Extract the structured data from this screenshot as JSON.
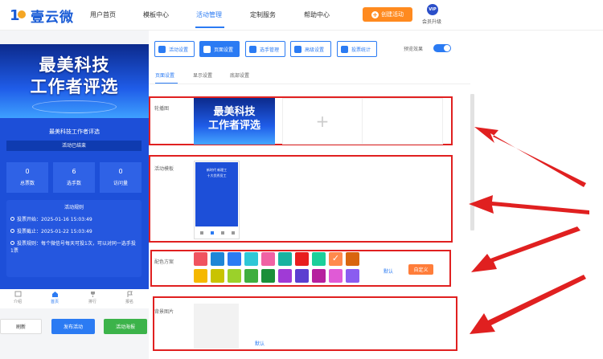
{
  "brand": {
    "name": "壹云微"
  },
  "nav": {
    "items": [
      "用户首页",
      "模板中心",
      "活动管理",
      "定制服务",
      "帮助中心"
    ],
    "create_label": "创建活动",
    "vip_badge": "VIP",
    "vip_label": "会员升级"
  },
  "preview": {
    "banner_line1": "最美科技",
    "banner_line2": "工作者评选",
    "title": "最美科技工作者评选",
    "status": "活动已结束",
    "stats": [
      {
        "value": "0",
        "label": "总票数"
      },
      {
        "value": "6",
        "label": "选手数"
      },
      {
        "value": "0",
        "label": "访问量"
      }
    ],
    "rules_header": "活动规则",
    "rules": [
      "投票开始：2025-01-16 15:03:49",
      "投票截止：2025-01-22 15:03:49",
      "投票规则：每个微信号每天可投1次，可以对同一选手投1票"
    ],
    "tabs": [
      "介绍",
      "首页",
      "排行",
      "报名"
    ],
    "actions": {
      "refresh": "刷新",
      "publish": "发布活动",
      "poster": "活动海报"
    }
  },
  "settings": {
    "buttons": [
      "活动设置",
      "页面设置",
      "选手管理",
      "高级设置",
      "投票统计"
    ],
    "preview_toggle_label": "预览效果",
    "preview_toggle_on": true,
    "subtabs": [
      "页面设置",
      "显示设置",
      "底部设置"
    ],
    "carousel_label": "轮播图",
    "carousel_line1": "最美科技",
    "carousel_line2": "工作者评选",
    "template_label": "活动模板",
    "template_thumb": [
      "新时代 新理工",
      "十大优秀员工"
    ],
    "color_label": "配色方案",
    "colors_row1": [
      "#f0535f",
      "#1f86d6",
      "#2b7bf3",
      "#2ec7d6",
      "#f062a4",
      "#19b3a1",
      "#e81e1e",
      "#1ccf9a",
      "#ff8a4c",
      "#d9650f"
    ],
    "colors_row2": [
      "#f5b800",
      "#c9c300",
      "#9bd12a",
      "#3fae3f",
      "#1b8f3a",
      "#a03ad6",
      "#5b3fd0",
      "#b6219e",
      "#e05ad6",
      "#8a5cf0"
    ],
    "selected_color": "#ff8a4c",
    "default_label": "默认",
    "custom_label": "自定义",
    "bg_label": "背景图片",
    "bg_default_label": "默认"
  }
}
